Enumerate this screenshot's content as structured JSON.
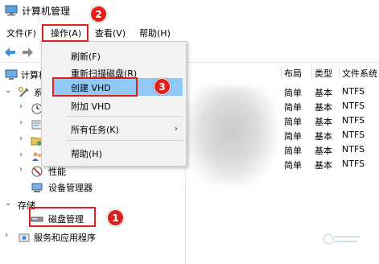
{
  "window": {
    "title": "计算机管理",
    "icon": "computer-management-icon"
  },
  "menubar": {
    "items": [
      {
        "label": "文件(F)"
      },
      {
        "label": "操作(A)"
      },
      {
        "label": "查看(V)"
      },
      {
        "label": "帮助(H)"
      }
    ]
  },
  "toolbar": {
    "buttons": [
      "back-arrow-icon",
      "forward-arrow-icon"
    ]
  },
  "dropdown": {
    "items": [
      {
        "label": "刷新(F)"
      },
      {
        "label": "重新扫描磁盘(R)"
      },
      {
        "label": "创建 VHD",
        "highlighted": true
      },
      {
        "label": "附加 VHD"
      },
      {
        "label": "所有任务(K)",
        "submenu": true
      },
      {
        "label": "帮助(H)"
      }
    ],
    "submenu_arrow": "›"
  },
  "tree": {
    "root_label": "计算机",
    "system_tools_label": "系",
    "performance_label": "性能",
    "device_manager_label": "设备管理器",
    "storage_label": "存储",
    "disk_management_label": "磁盘管理",
    "services_label": "服务和应用程序"
  },
  "table": {
    "columns": [
      "布局",
      "类型",
      "文件系统"
    ],
    "rows": [
      [
        "简单",
        "基本",
        "NTFS"
      ],
      [
        "简单",
        "基本",
        "NTFS"
      ],
      [
        "简单",
        "基本",
        "NTFS"
      ],
      [
        "简单",
        "基本",
        "NTFS"
      ],
      [
        "简单",
        "基本",
        "NTFS"
      ],
      [
        "简单",
        "基本",
        "NTFS"
      ]
    ]
  },
  "annotations": {
    "step1": "1",
    "step2": "2",
    "step3": "3",
    "color": "#e0201b"
  },
  "colors": {
    "highlight": "#91c9f7",
    "menu_bg": "#f2f2f2"
  }
}
